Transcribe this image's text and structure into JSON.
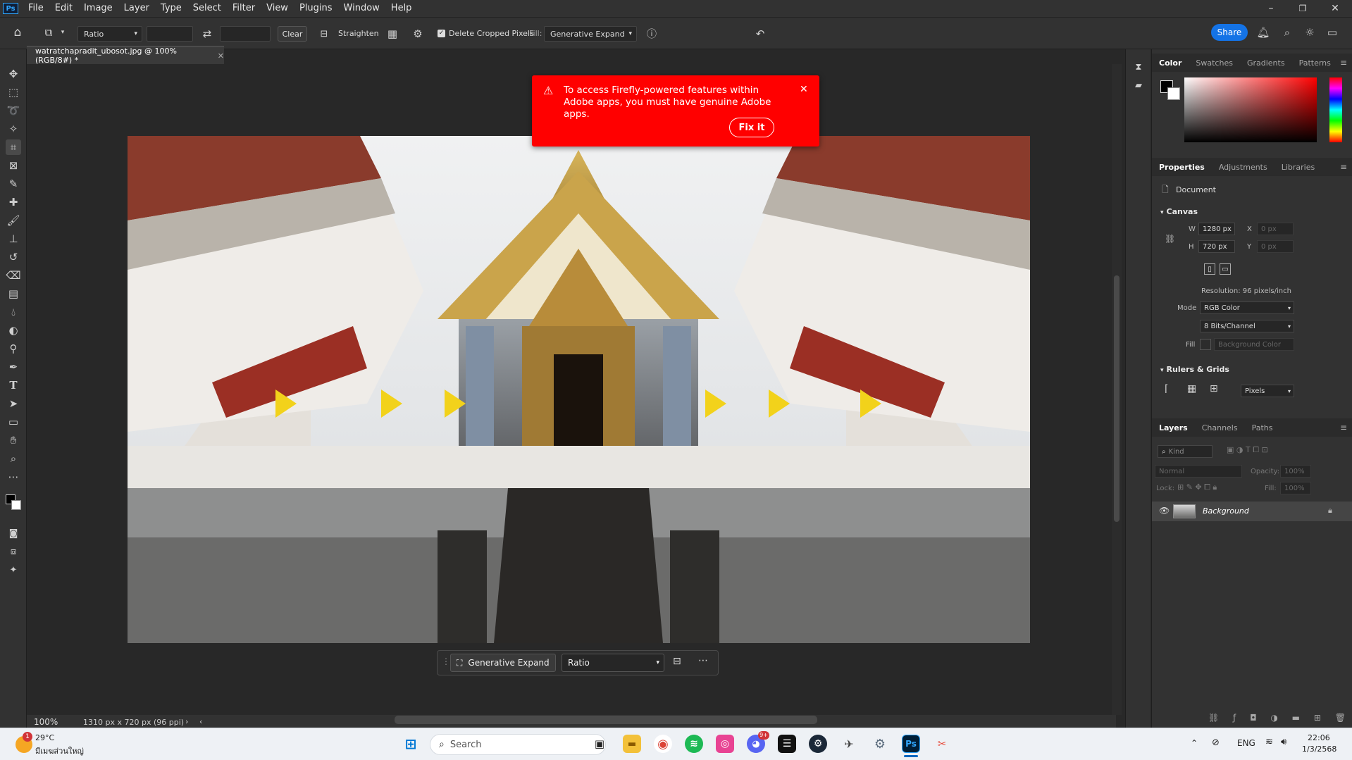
{
  "menubar": {
    "logo": "Ps",
    "items": [
      "File",
      "Edit",
      "Image",
      "Layer",
      "Type",
      "Select",
      "Filter",
      "View",
      "Plugins",
      "Window",
      "Help"
    ]
  },
  "window_controls": {
    "minimize": "–",
    "restore": "❐",
    "close": "✕"
  },
  "options_bar": {
    "ratio_select": "Ratio",
    "clear_label": "Clear",
    "straighten_label": "Straighten",
    "delete_cropped_label": "Delete Cropped Pixels",
    "delete_cropped_checked": true,
    "fill_label": "Fill:",
    "fill_value": "Generative Expand",
    "share_label": "Share"
  },
  "document": {
    "tab_title": "watratchapradit_ubosot.jpg @ 100% (RGB/8#) *",
    "zoom": "100%",
    "doc_info": "1310 px x 720 px (96 ppi)"
  },
  "toast": {
    "message": "To access Firefly-powered features within Adobe apps, you must have genuine Adobe apps.",
    "action_label": "Fix it",
    "background": "#ff0000"
  },
  "context_bar": {
    "generative_label": "Generative Expand",
    "ratio_value": "Ratio"
  },
  "color_panel": {
    "tabs": [
      "Color",
      "Swatches",
      "Gradients",
      "Patterns"
    ],
    "hue_accent": "#ff0000"
  },
  "properties_panel": {
    "tabs": [
      "Properties",
      "Adjustments",
      "Libraries"
    ],
    "doc_label": "Document",
    "canvas_header": "Canvas",
    "w_label": "W",
    "w_value": "1280 px",
    "h_label": "H",
    "h_value": "720 px",
    "x_label": "X",
    "x_value": "0 px",
    "y_label": "Y",
    "y_value": "0 px",
    "resolution": "Resolution: 96 pixels/inch",
    "mode_label": "Mode",
    "mode_value": "RGB Color",
    "bits_value": "8 Bits/Channel",
    "fill_label": "Fill",
    "fill_value": "Background Color",
    "rulers_header": "Rulers & Grids",
    "units_value": "Pixels"
  },
  "layers_panel": {
    "tabs": [
      "Layers",
      "Channels",
      "Paths"
    ],
    "filter_placeholder": "Kind",
    "blend_mode": "Normal",
    "opacity_label": "Opacity:",
    "opacity_value": "100%",
    "lock_label": "Lock:",
    "fill_label": "Fill:",
    "fill_value": "100%",
    "layer_name": "Background"
  },
  "taskbar": {
    "weather_temp": "29°C",
    "weather_desc": "มีเมฆส่วนใหญ่",
    "weather_badge": "1",
    "search_placeholder": "Search",
    "language": "ENG",
    "time": "22:06",
    "date": "1/3/2568",
    "discord_badge": "9+"
  }
}
